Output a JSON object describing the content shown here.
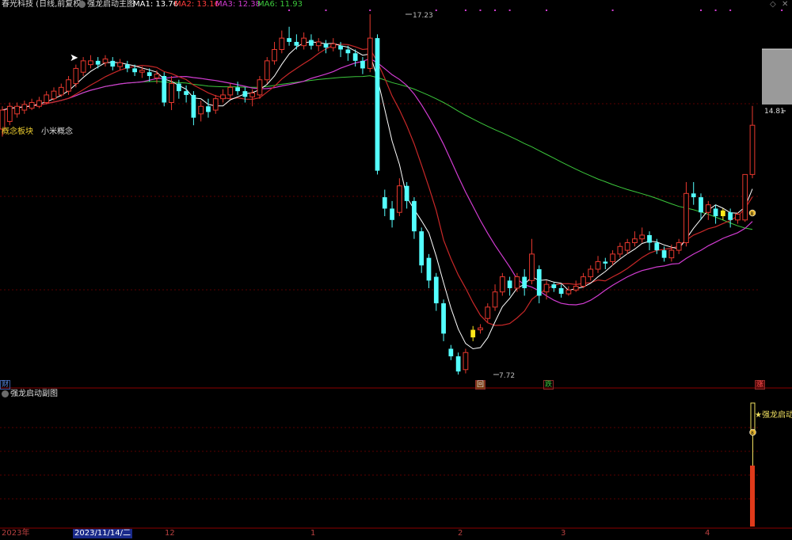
{
  "header": {
    "stock_name": "春光科技 (日线,前复权)",
    "indicator_name": "强龙启动主图",
    "ma1_label": "MA1: 13.76",
    "ma2_label": "MA2: 13.16",
    "ma3_label": "MA3: 12.38",
    "ma6_label": "MA6: 11.93",
    "colors": {
      "ma1": "#ffffff",
      "ma2": "#ff3b3b",
      "ma3": "#d23cd2",
      "ma6": "#3cc83c"
    }
  },
  "window_controls": {
    "restore_icon": "◇",
    "close_icon": "✕"
  },
  "main_chart": {
    "concept_label": "概念板块",
    "concept_value": "小米概念",
    "high_label": "17.23",
    "low_label": "7.72",
    "right_price_label": "14.81",
    "marker_left": "财",
    "marker_hui": "回",
    "marker_die": "跌",
    "marker_zhang": "涨",
    "ma_circle_label": "8"
  },
  "sub_chart": {
    "title": "强龙启动副图",
    "signal_label": "★强龙启动",
    "circle_label": "8"
  },
  "time_axis": {
    "labels": [
      "2023年",
      "2023/11/14/二",
      "12",
      "1",
      "2",
      "3",
      "4"
    ]
  },
  "chart_data": {
    "type": "candlestick",
    "price_range": [
      7.72,
      17.23
    ],
    "candles": [
      {
        "o": 14.2,
        "c": 14.7,
        "h": 14.8,
        "l": 14.0
      },
      {
        "o": 14.4,
        "c": 14.8,
        "h": 14.9,
        "l": 14.3
      },
      {
        "o": 14.6,
        "c": 14.8,
        "h": 14.9,
        "l": 14.5
      },
      {
        "o": 14.7,
        "c": 14.85,
        "h": 14.95,
        "l": 14.6
      },
      {
        "o": 14.75,
        "c": 14.9,
        "h": 15.0,
        "l": 14.7
      },
      {
        "o": 14.8,
        "c": 14.95,
        "h": 15.05,
        "l": 14.75
      },
      {
        "o": 14.9,
        "c": 15.1,
        "h": 15.2,
        "l": 14.85
      },
      {
        "o": 15.0,
        "c": 15.2,
        "h": 15.3,
        "l": 14.95
      },
      {
        "o": 15.1,
        "c": 15.3,
        "h": 15.4,
        "l": 15.05
      },
      {
        "o": 15.2,
        "c": 15.5,
        "h": 15.6,
        "l": 15.1
      },
      {
        "o": 15.4,
        "c": 15.8,
        "h": 15.9,
        "l": 15.3
      },
      {
        "o": 15.7,
        "c": 16.0,
        "h": 16.1,
        "l": 15.6
      },
      {
        "o": 15.9,
        "c": 16.0,
        "h": 16.15,
        "l": 15.8
      },
      {
        "o": 16.0,
        "c": 15.9,
        "h": 16.1,
        "l": 15.8
      },
      {
        "o": 15.95,
        "c": 16.05,
        "h": 16.15,
        "l": 15.85
      },
      {
        "o": 16.0,
        "c": 15.85,
        "h": 16.1,
        "l": 15.75
      },
      {
        "o": 15.85,
        "c": 15.95,
        "h": 16.05,
        "l": 15.75
      },
      {
        "o": 15.9,
        "c": 15.8,
        "h": 16.0,
        "l": 15.7
      },
      {
        "o": 15.8,
        "c": 15.7,
        "h": 15.9,
        "l": 15.6
      },
      {
        "o": 15.7,
        "c": 15.75,
        "h": 15.85,
        "l": 15.55
      },
      {
        "o": 15.7,
        "c": 15.6,
        "h": 15.8,
        "l": 15.45
      },
      {
        "o": 15.55,
        "c": 15.65,
        "h": 15.75,
        "l": 15.4
      },
      {
        "o": 15.6,
        "c": 14.9,
        "h": 15.7,
        "l": 14.8
      },
      {
        "o": 14.9,
        "c": 15.4,
        "h": 15.6,
        "l": 14.7
      },
      {
        "o": 15.4,
        "c": 15.2,
        "h": 15.5,
        "l": 15.0
      },
      {
        "o": 15.2,
        "c": 15.1,
        "h": 15.35,
        "l": 14.9
      },
      {
        "o": 15.1,
        "c": 14.5,
        "h": 15.2,
        "l": 14.3
      },
      {
        "o": 14.6,
        "c": 14.8,
        "h": 14.95,
        "l": 14.4
      },
      {
        "o": 14.8,
        "c": 14.65,
        "h": 15.0,
        "l": 14.5
      },
      {
        "o": 14.7,
        "c": 15.0,
        "h": 15.1,
        "l": 14.6
      },
      {
        "o": 15.0,
        "c": 15.1,
        "h": 15.25,
        "l": 14.9
      },
      {
        "o": 15.1,
        "c": 15.3,
        "h": 15.4,
        "l": 15.0
      },
      {
        "o": 15.3,
        "c": 15.2,
        "h": 15.45,
        "l": 15.1
      },
      {
        "o": 15.2,
        "c": 15.05,
        "h": 15.3,
        "l": 14.9
      },
      {
        "o": 15.05,
        "c": 15.15,
        "h": 15.25,
        "l": 14.8
      },
      {
        "o": 15.1,
        "c": 15.5,
        "h": 15.6,
        "l": 15.0
      },
      {
        "o": 15.5,
        "c": 16.0,
        "h": 16.1,
        "l": 15.4
      },
      {
        "o": 16.0,
        "c": 16.3,
        "h": 16.5,
        "l": 15.9
      },
      {
        "o": 16.3,
        "c": 16.6,
        "h": 16.8,
        "l": 16.2
      },
      {
        "o": 16.6,
        "c": 16.5,
        "h": 16.9,
        "l": 16.4
      },
      {
        "o": 16.5,
        "c": 16.4,
        "h": 16.7,
        "l": 16.3
      },
      {
        "o": 16.4,
        "c": 16.6,
        "h": 16.75,
        "l": 16.3
      },
      {
        "o": 16.55,
        "c": 16.4,
        "h": 16.7,
        "l": 16.3
      },
      {
        "o": 16.4,
        "c": 16.5,
        "h": 16.6,
        "l": 16.25
      },
      {
        "o": 16.45,
        "c": 16.35,
        "h": 16.55,
        "l": 16.2
      },
      {
        "o": 16.35,
        "c": 16.45,
        "h": 16.6,
        "l": 16.25
      },
      {
        "o": 16.4,
        "c": 16.3,
        "h": 16.5,
        "l": 16.1
      },
      {
        "o": 16.3,
        "c": 16.2,
        "h": 16.4,
        "l": 16.0
      },
      {
        "o": 16.2,
        "c": 16.0,
        "h": 16.3,
        "l": 15.85
      },
      {
        "o": 16.0,
        "c": 15.8,
        "h": 16.1,
        "l": 15.65
      },
      {
        "o": 15.8,
        "c": 16.6,
        "h": 17.23,
        "l": 15.7
      },
      {
        "o": 16.6,
        "c": 13.1,
        "h": 16.7,
        "l": 13.0
      },
      {
        "o": 12.4,
        "c": 12.1,
        "h": 12.6,
        "l": 11.9
      },
      {
        "o": 12.1,
        "c": 11.8,
        "h": 12.3,
        "l": 11.6
      },
      {
        "o": 12.0,
        "c": 12.7,
        "h": 12.9,
        "l": 11.9
      },
      {
        "o": 12.7,
        "c": 12.3,
        "h": 12.8,
        "l": 12.1
      },
      {
        "o": 12.3,
        "c": 11.5,
        "h": 12.4,
        "l": 11.3
      },
      {
        "o": 11.5,
        "c": 10.6,
        "h": 11.6,
        "l": 10.4
      },
      {
        "o": 10.8,
        "c": 10.2,
        "h": 10.9,
        "l": 10.0
      },
      {
        "o": 10.3,
        "c": 9.6,
        "h": 10.4,
        "l": 9.4
      },
      {
        "o": 9.6,
        "c": 8.8,
        "h": 9.7,
        "l": 8.6
      },
      {
        "o": 8.4,
        "c": 8.2,
        "h": 8.5,
        "l": 8.1
      },
      {
        "o": 8.2,
        "c": 7.8,
        "h": 8.3,
        "l": 7.72
      },
      {
        "o": 7.85,
        "c": 8.3,
        "h": 8.4,
        "l": 7.75
      },
      {
        "o": 8.7,
        "c": 8.9,
        "h": 9.0,
        "l": 8.6
      },
      {
        "o": 8.9,
        "c": 8.95,
        "h": 9.05,
        "l": 8.8
      },
      {
        "o": 9.2,
        "c": 9.5,
        "h": 9.6,
        "l": 9.1
      },
      {
        "o": 9.5,
        "c": 9.9,
        "h": 10.1,
        "l": 9.4
      },
      {
        "o": 9.9,
        "c": 10.3,
        "h": 10.4,
        "l": 9.8
      },
      {
        "o": 10.2,
        "c": 10.0,
        "h": 10.3,
        "l": 9.8
      },
      {
        "o": 10.0,
        "c": 10.3,
        "h": 10.4,
        "l": 9.9
      },
      {
        "o": 10.3,
        "c": 10.0,
        "h": 10.5,
        "l": 9.8
      },
      {
        "o": 10.2,
        "c": 10.9,
        "h": 11.3,
        "l": 10.1
      },
      {
        "o": 10.5,
        "c": 9.8,
        "h": 10.6,
        "l": 9.6
      },
      {
        "o": 9.9,
        "c": 10.1,
        "h": 10.2,
        "l": 9.7
      },
      {
        "o": 10.1,
        "c": 10.0,
        "h": 10.15,
        "l": 9.9
      },
      {
        "o": 10.0,
        "c": 9.85,
        "h": 10.1,
        "l": 9.75
      },
      {
        "o": 9.85,
        "c": 9.95,
        "h": 10.05,
        "l": 9.8
      },
      {
        "o": 9.95,
        "c": 10.05,
        "h": 10.2,
        "l": 9.9
      },
      {
        "o": 10.05,
        "c": 10.3,
        "h": 10.4,
        "l": 10.0
      },
      {
        "o": 10.3,
        "c": 10.5,
        "h": 10.6,
        "l": 10.2
      },
      {
        "o": 10.5,
        "c": 10.7,
        "h": 10.85,
        "l": 10.4
      },
      {
        "o": 10.7,
        "c": 10.65,
        "h": 10.8,
        "l": 10.5
      },
      {
        "o": 10.7,
        "c": 10.9,
        "h": 11.0,
        "l": 10.6
      },
      {
        "o": 10.9,
        "c": 11.1,
        "h": 11.2,
        "l": 10.8
      },
      {
        "o": 11.0,
        "c": 11.2,
        "h": 11.3,
        "l": 10.9
      },
      {
        "o": 11.2,
        "c": 11.3,
        "h": 11.5,
        "l": 11.1
      },
      {
        "o": 11.3,
        "c": 11.4,
        "h": 11.6,
        "l": 11.2
      },
      {
        "o": 11.4,
        "c": 11.2,
        "h": 11.5,
        "l": 11.0
      },
      {
        "o": 11.2,
        "c": 11.0,
        "h": 11.3,
        "l": 10.9
      },
      {
        "o": 11.0,
        "c": 10.8,
        "h": 11.1,
        "l": 10.7
      },
      {
        "o": 10.8,
        "c": 11.0,
        "h": 11.15,
        "l": 10.7
      },
      {
        "o": 11.0,
        "c": 11.2,
        "h": 11.3,
        "l": 10.9
      },
      {
        "o": 11.2,
        "c": 12.5,
        "h": 12.8,
        "l": 11.1
      },
      {
        "o": 12.5,
        "c": 12.4,
        "h": 12.8,
        "l": 12.2
      },
      {
        "o": 12.4,
        "c": 12.0,
        "h": 12.5,
        "l": 11.8
      },
      {
        "o": 12.0,
        "c": 12.2,
        "h": 12.3,
        "l": 11.8
      },
      {
        "o": 12.1,
        "c": 11.9,
        "h": 12.2,
        "l": 11.7
      },
      {
        "o": 11.9,
        "c": 12.05,
        "h": 12.1,
        "l": 11.8
      },
      {
        "o": 12.0,
        "c": 11.8,
        "h": 12.1,
        "l": 11.6
      },
      {
        "o": 11.8,
        "c": 11.95,
        "h": 12.0,
        "l": 11.7
      },
      {
        "o": 11.8,
        "c": 13.0,
        "h": 13.0,
        "l": 11.75
      },
      {
        "o": 13.0,
        "c": 14.3,
        "h": 14.81,
        "l": 12.9
      }
    ],
    "yellow_candles": [
      64,
      98,
      109
    ]
  }
}
